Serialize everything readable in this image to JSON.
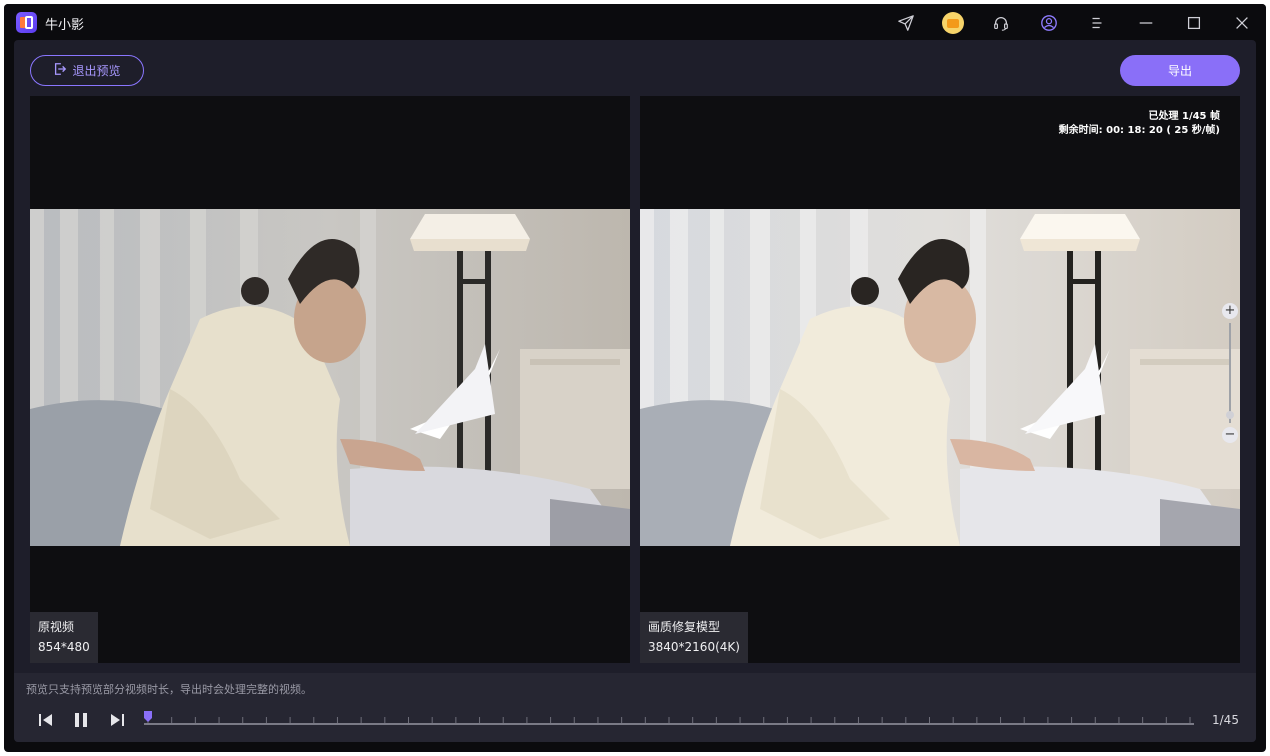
{
  "app": {
    "title": "牛小影"
  },
  "titlebar_icons": [
    "send-icon",
    "vip-cart-icon",
    "headset-icon",
    "user-icon",
    "menu-icon",
    "minimize-icon",
    "maximize-icon",
    "close-icon"
  ],
  "toolbar": {
    "exit_label": "退出预览",
    "export_label": "导出"
  },
  "left_panel": {
    "name": "原视频",
    "resolution": "854*480"
  },
  "right_panel": {
    "name": "画质修复模型",
    "resolution": "3840*2160(4K)",
    "processed_label": "已处理 1/45 帧",
    "remaining_label": "剩余时间: 00: 18: 20 ( 25 秒/帧)"
  },
  "bottom": {
    "note": "预览只支持预览部分视频时长，导出时会处理完整的视频。",
    "frame_counter": "1/45",
    "current_frame": 1,
    "total_frames": 45
  },
  "colors": {
    "accent": "#8a6ff8",
    "panel_bg": "#0e0e11",
    "content_bg": "#1e1e2a"
  }
}
